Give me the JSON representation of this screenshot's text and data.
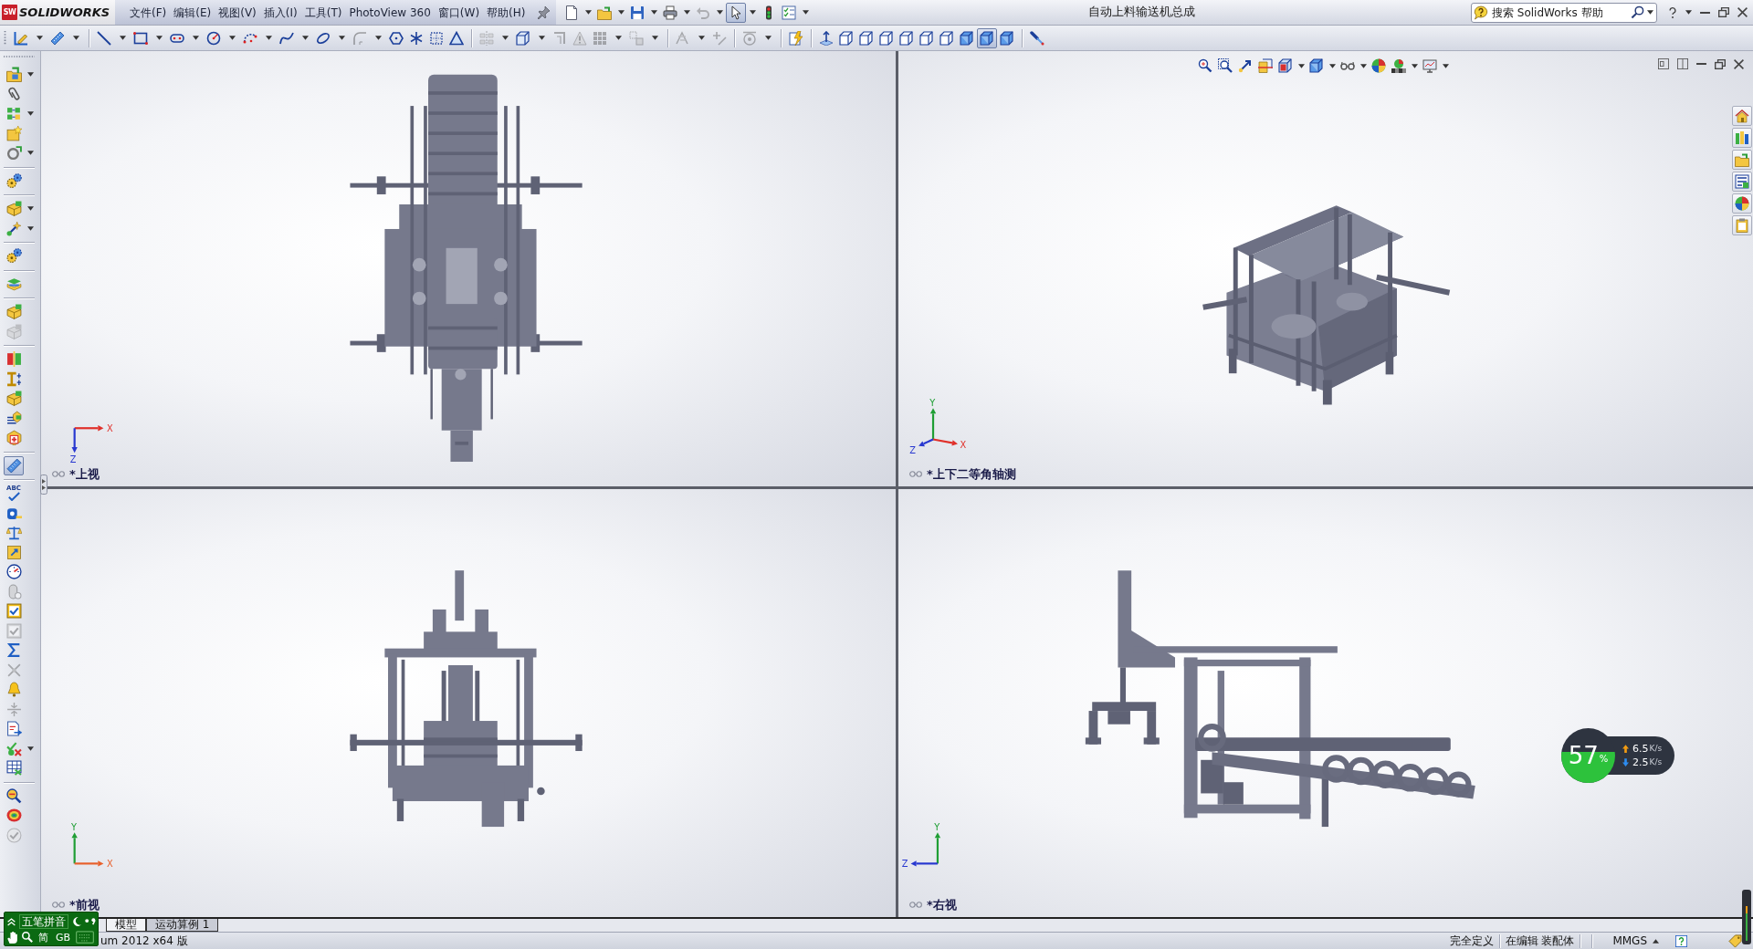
{
  "title_bar": {
    "logo_mark": "SW",
    "app_name": "SOLIDWORKS",
    "menus": [
      "文件(F)",
      "编辑(E)",
      "视图(V)",
      "插入(I)",
      "工具(T)",
      "PhotoView 360",
      "窗口(W)",
      "帮助(H)"
    ],
    "quick_tools": [
      {
        "selected": false,
        "disabled": false,
        "dropdown": true
      },
      {
        "selected": false,
        "disabled": false,
        "dropdown": true
      },
      {
        "selected": false,
        "disabled": false,
        "dropdown": true
      },
      {
        "selected": false,
        "disabled": false,
        "dropdown": true
      },
      {
        "selected": false,
        "disabled": true,
        "dropdown": true
      },
      {
        "selected": true,
        "disabled": false,
        "dropdown": true
      },
      {
        "selected": false,
        "disabled": false,
        "dropdown": false
      },
      {
        "selected": false,
        "disabled": false,
        "dropdown": true
      }
    ],
    "document_title": "自动上料输送机总成",
    "search": {
      "placeholder": "搜索 SolidWorks 帮助"
    }
  },
  "command_toolbar": [
    [
      {
        "selected": false,
        "disabled": false,
        "dropdown": true
      },
      {
        "selected": false,
        "disabled": false,
        "dropdown": true
      }
    ],
    [
      {
        "selected": false,
        "disabled": false,
        "dropdown": true
      },
      {
        "selected": false,
        "disabled": false,
        "dropdown": true
      },
      {
        "selected": false,
        "disabled": false,
        "dropdown": true
      },
      {
        "selected": false,
        "disabled": false,
        "dropdown": true
      },
      {
        "selected": false,
        "disabled": false,
        "dropdown": true
      },
      {
        "selected": false,
        "disabled": false,
        "dropdown": true
      },
      {
        "selected": false,
        "disabled": false,
        "dropdown": true
      },
      {
        "selected": false,
        "disabled": true,
        "dropdown": true
      },
      {
        "selected": false,
        "disabled": false,
        "dropdown": false
      },
      {
        "selected": false,
        "disabled": false,
        "dropdown": false
      },
      {
        "selected": false,
        "disabled": false,
        "dropdown": false
      },
      {
        "selected": false,
        "disabled": false,
        "dropdown": false
      }
    ],
    [
      {
        "selected": false,
        "disabled": true,
        "dropdown": true
      },
      {
        "selected": false,
        "disabled": false,
        "dropdown": true
      },
      {
        "selected": false,
        "disabled": true,
        "dropdown": false
      },
      {
        "selected": false,
        "disabled": true,
        "dropdown": false
      },
      {
        "selected": false,
        "disabled": true,
        "dropdown": true
      },
      {
        "selected": false,
        "disabled": true,
        "dropdown": true
      }
    ],
    [
      {
        "selected": false,
        "disabled": true,
        "dropdown": true
      },
      {
        "selected": false,
        "disabled": true,
        "dropdown": false
      }
    ],
    [
      {
        "selected": false,
        "disabled": true,
        "dropdown": true
      }
    ],
    [
      {
        "selected": false,
        "disabled": false,
        "dropdown": false
      }
    ],
    [
      {
        "selected": false,
        "disabled": false,
        "dropdown": false
      },
      {
        "selected": false,
        "disabled": false,
        "dropdown": false
      },
      {
        "selected": false,
        "disabled": false,
        "dropdown": false
      },
      {
        "selected": false,
        "disabled": false,
        "dropdown": false
      },
      {
        "selected": false,
        "disabled": false,
        "dropdown": false
      },
      {
        "selected": false,
        "disabled": false,
        "dropdown": false
      },
      {
        "selected": false,
        "disabled": false,
        "dropdown": false
      },
      {
        "selected": false,
        "disabled": false,
        "dropdown": false
      },
      {
        "selected": true,
        "disabled": false,
        "dropdown": false
      },
      {
        "selected": false,
        "disabled": false,
        "dropdown": false
      }
    ],
    [
      {
        "selected": false,
        "disabled": false,
        "dropdown": false
      }
    ]
  ],
  "left_toolbar": [
    [
      {
        "selected": false,
        "disabled": false,
        "dropdown": true
      },
      {
        "selected": false,
        "disabled": false,
        "dropdown": false
      },
      {
        "selected": false,
        "disabled": false,
        "dropdown": true
      },
      {
        "selected": false,
        "disabled": false,
        "dropdown": false
      },
      {
        "selected": false,
        "disabled": false,
        "dropdown": true
      }
    ],
    [
      {
        "selected": false,
        "disabled": false,
        "dropdown": false
      }
    ],
    [
      {
        "selected": false,
        "disabled": false,
        "dropdown": true
      },
      {
        "selected": false,
        "disabled": false,
        "dropdown": true
      }
    ],
    [
      {
        "selected": false,
        "disabled": false,
        "dropdown": false
      }
    ],
    [
      {
        "selected": false,
        "disabled": false,
        "dropdown": false
      }
    ],
    [
      {
        "selected": false,
        "disabled": false,
        "dropdown": false
      },
      {
        "selected": false,
        "disabled": true,
        "dropdown": false
      }
    ],
    [
      {
        "selected": false,
        "disabled": false,
        "dropdown": false
      },
      {
        "selected": false,
        "disabled": false,
        "dropdown": false
      },
      {
        "selected": false,
        "disabled": false,
        "dropdown": false
      },
      {
        "selected": false,
        "disabled": false,
        "dropdown": false
      },
      {
        "selected": false,
        "disabled": false,
        "dropdown": false
      }
    ],
    [
      {
        "selected": true,
        "disabled": false,
        "dropdown": false
      }
    ],
    [
      {
        "label": "ABC",
        "selected": false,
        "disabled": false,
        "dropdown": false
      },
      {
        "selected": false,
        "disabled": false,
        "dropdown": false
      },
      {
        "selected": false,
        "disabled": false,
        "dropdown": false
      },
      {
        "selected": false,
        "disabled": false,
        "dropdown": false
      },
      {
        "selected": false,
        "disabled": false,
        "dropdown": false
      },
      {
        "selected": false,
        "disabled": true,
        "dropdown": false
      },
      {
        "selected": false,
        "disabled": false,
        "dropdown": false
      },
      {
        "selected": false,
        "disabled": true,
        "dropdown": false
      },
      {
        "selected": false,
        "disabled": false,
        "dropdown": false
      },
      {
        "selected": false,
        "disabled": true,
        "dropdown": false
      },
      {
        "selected": false,
        "disabled": false,
        "dropdown": false
      },
      {
        "selected": false,
        "disabled": true,
        "dropdown": false
      },
      {
        "selected": false,
        "disabled": false,
        "dropdown": false
      },
      {
        "selected": false,
        "disabled": false,
        "dropdown": true
      },
      {
        "selected": false,
        "disabled": false,
        "dropdown": false
      }
    ],
    [
      {
        "selected": false,
        "disabled": false,
        "dropdown": false
      },
      {
        "selected": false,
        "disabled": false,
        "dropdown": false
      },
      {
        "selected": false,
        "disabled": true,
        "dropdown": false
      }
    ]
  ],
  "viewports": [
    {
      "kind": "top",
      "label": "*上视",
      "axes": [
        {
          "label": "X",
          "kind": "right",
          "color": "#e0302a"
        },
        {
          "label": "Z",
          "kind": "down",
          "color": "#2838d0"
        }
      ]
    },
    {
      "kind": "isometric",
      "label": "*上下二等角轴测",
      "axes": [
        {
          "label": "Y",
          "kind": "up",
          "color": "#1f9e34"
        },
        {
          "label": "X",
          "kind": "downright",
          "color": "#e0302a"
        },
        {
          "label": "Z",
          "kind": "downleft",
          "color": "#2838d0"
        }
      ],
      "view_toolbar": [
        {
          "dropdown": false
        },
        {
          "dropdown": false
        },
        {
          "dropdown": false
        },
        {
          "dropdown": false
        },
        {
          "dropdown": true
        },
        {
          "dropdown": true
        },
        {
          "dropdown": true
        },
        {
          "dropdown": false
        },
        {
          "dropdown": true
        },
        {
          "dropdown": true
        }
      ]
    },
    {
      "kind": "front",
      "label": "*前视",
      "axes": [
        {
          "label": "Y",
          "kind": "up",
          "color": "#1f9e34"
        },
        {
          "label": "X",
          "kind": "right",
          "color": "#e8602b"
        }
      ]
    },
    {
      "kind": "side",
      "label": "*右视",
      "axes": [
        {
          "label": "Y",
          "kind": "up",
          "color": "#1f9e34"
        },
        {
          "label": "Z",
          "kind": "left",
          "color": "#2838d0"
        }
      ]
    }
  ],
  "tabs": [
    {
      "label": "模型",
      "selected": true
    },
    {
      "label": "运动算例 1",
      "selected": false
    }
  ],
  "status_bar": {
    "version": "um 2012 x64 版",
    "state": "完全定义",
    "mode": "在编辑 装配体",
    "units": "MMGS"
  },
  "ime_bar": {
    "name": "五笔拼音",
    "charset": "简",
    "encoding": "GB"
  },
  "network_meter": {
    "level": 0.57,
    "percent": "57",
    "percent_sign": "%",
    "upload": "6.5",
    "upload_unit": "K/s",
    "download": "2.5",
    "download_unit": "K/s"
  }
}
